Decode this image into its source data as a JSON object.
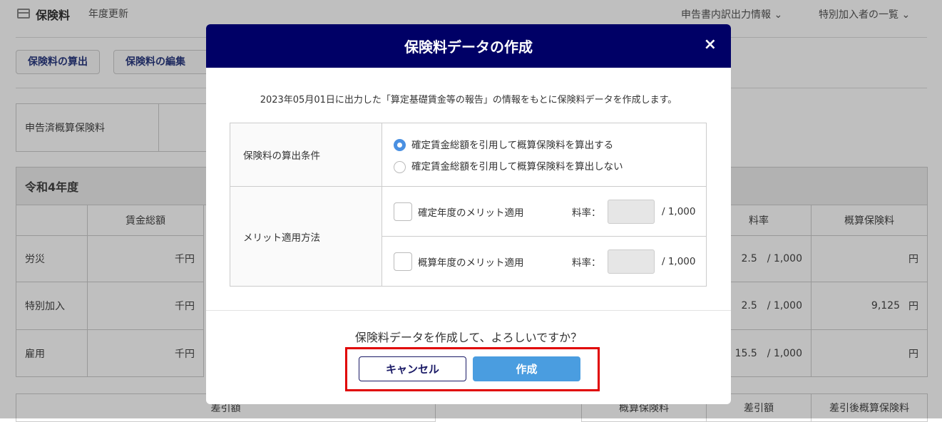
{
  "page": {
    "title": "保険料",
    "subtitle": "年度更新",
    "links": [
      "申告書内訳出力情報",
      "特別加入者の一覧"
    ],
    "buttons": [
      "保険料の算出",
      "保険料の編集"
    ],
    "declared_label": "申告済概算保険料",
    "year_label": "令和4年度",
    "columns": {
      "wage": "賃金総額",
      "rate": "料率",
      "premium": "概算保険料"
    },
    "rows": [
      {
        "label": "労災",
        "wage_unit": "千円",
        "rate": "2.5",
        "rate_den": "/ 1,000",
        "premium": "",
        "yen": "円"
      },
      {
        "label": "特別加入",
        "wage_unit": "千円",
        "rate": "2.5",
        "rate_den": "/ 1,000",
        "premium": "9,125",
        "yen": "円"
      },
      {
        "label": "雇用",
        "wage_unit": "千円",
        "rate": "15.5",
        "rate_den": "/ 1,000",
        "premium": "",
        "yen": "円"
      }
    ],
    "bottom_headers": [
      "差引額",
      "概算保険料",
      "差引額",
      "差引後概算保険料"
    ]
  },
  "modal": {
    "title": "保険料データの作成",
    "close": "×",
    "description": "2023年05月01日に出力した「算定基礎賃金等の報告」の情報をもとに保険料データを作成します。",
    "calc_label": "保険料の算出条件",
    "calc_options": [
      "確定賃金総額を引用して概算保険料を算出する",
      "確定賃金総額を引用して概算保険料を算出しない"
    ],
    "merit_label": "メリット適用方法",
    "merit_options": [
      {
        "label": "確定年度のメリット適用",
        "rate_label": "料率：",
        "den": "/ 1,000"
      },
      {
        "label": "概算年度のメリット適用",
        "rate_label": "料率：",
        "den": "/ 1,000"
      }
    ],
    "question": "保険料データを作成して、よろしいですか？",
    "cancel": "キャンセル",
    "create": "作成"
  }
}
